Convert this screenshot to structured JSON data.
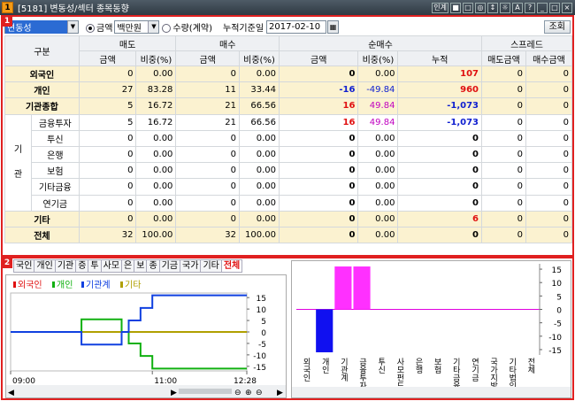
{
  "window": {
    "number": "1",
    "title": "[5181] 변동성/섹터 종목동향",
    "controls": [
      "인계",
      "■",
      "□",
      "◎",
      "↕",
      "☼",
      "A",
      "?",
      "_",
      "□",
      "×"
    ]
  },
  "toolbar": {
    "sector_value": "변동성",
    "radio_amount_label": "금액",
    "unit_value": "백만원",
    "radio_qty_label": "수량(계약)",
    "date_label": "누적기준일",
    "date_value": "2017-02-10",
    "query_button": "조회"
  },
  "table": {
    "group_headers": {
      "type": "구분",
      "sell": "매도",
      "buy": "매수",
      "net": "순매수",
      "spread": "스프레드"
    },
    "sub_headers": [
      "금액",
      "비중(%)",
      "금액",
      "비중(%)",
      "금액",
      "비중(%)",
      "누적",
      "매도금액",
      "매수금액"
    ],
    "institution_side_label": [
      "기",
      "관"
    ],
    "rows": [
      {
        "label": "외국인",
        "cells": [
          "0",
          "0.00",
          "0",
          "0.00",
          "0",
          "0.00",
          "107",
          "0",
          "0"
        ],
        "colors": [
          "",
          "",
          "",
          "",
          "",
          "",
          "red",
          "",
          ""
        ],
        "bold_label": true,
        "style": "y"
      },
      {
        "label": "개인",
        "cells": [
          "27",
          "83.28",
          "11",
          "33.44",
          "-16",
          "-49.84",
          "960",
          "0",
          "0"
        ],
        "colors": [
          "",
          "",
          "",
          "",
          "blue",
          "blue",
          "red",
          "",
          ""
        ],
        "bold_label": true,
        "style": "y"
      },
      {
        "label": "기관종합",
        "cells": [
          "5",
          "16.72",
          "21",
          "66.56",
          "16",
          "49.84",
          "-1,073",
          "0",
          "0"
        ],
        "colors": [
          "",
          "",
          "",
          "",
          "red",
          "mag",
          "blue",
          "",
          ""
        ],
        "bold_label": true,
        "style": "y"
      },
      {
        "label": "금융투자",
        "cells": [
          "5",
          "16.72",
          "21",
          "66.56",
          "16",
          "49.84",
          "-1,073",
          "0",
          "0"
        ],
        "colors": [
          "",
          "",
          "",
          "",
          "red",
          "mag",
          "blue",
          "",
          ""
        ],
        "bold_label": false,
        "style": ""
      },
      {
        "label": "투신",
        "cells": [
          "0",
          "0.00",
          "0",
          "0.00",
          "0",
          "0.00",
          "0",
          "0",
          "0"
        ],
        "colors": [
          "",
          "",
          "",
          "",
          "",
          "",
          "",
          "",
          ""
        ],
        "bold_label": false,
        "style": ""
      },
      {
        "label": "은행",
        "cells": [
          "0",
          "0.00",
          "0",
          "0.00",
          "0",
          "0.00",
          "0",
          "0",
          "0"
        ],
        "colors": [
          "",
          "",
          "",
          "",
          "",
          "",
          "",
          "",
          ""
        ],
        "bold_label": false,
        "style": ""
      },
      {
        "label": "보험",
        "cells": [
          "0",
          "0.00",
          "0",
          "0.00",
          "0",
          "0.00",
          "0",
          "0",
          "0"
        ],
        "colors": [
          "",
          "",
          "",
          "",
          "",
          "",
          "",
          "",
          ""
        ],
        "bold_label": false,
        "style": ""
      },
      {
        "label": "기타금융",
        "cells": [
          "0",
          "0.00",
          "0",
          "0.00",
          "0",
          "0.00",
          "0",
          "0",
          "0"
        ],
        "colors": [
          "",
          "",
          "",
          "",
          "",
          "",
          "",
          "",
          ""
        ],
        "bold_label": false,
        "style": ""
      },
      {
        "label": "연기금",
        "cells": [
          "0",
          "0.00",
          "0",
          "0.00",
          "0",
          "0.00",
          "0",
          "0",
          "0"
        ],
        "colors": [
          "",
          "",
          "",
          "",
          "",
          "",
          "",
          "",
          ""
        ],
        "bold_label": false,
        "style": ""
      },
      {
        "label": "기타",
        "cells": [
          "0",
          "0.00",
          "0",
          "0.00",
          "0",
          "0.00",
          "6",
          "0",
          "0"
        ],
        "colors": [
          "",
          "",
          "",
          "",
          "",
          "",
          "red",
          "",
          ""
        ],
        "bold_label": true,
        "style": "y"
      },
      {
        "label": "전체",
        "cells": [
          "32",
          "100.00",
          "32",
          "100.00",
          "0",
          "0.00",
          "0",
          "0",
          "0"
        ],
        "colors": [
          "",
          "",
          "",
          "",
          "",
          "",
          "",
          "",
          ""
        ],
        "bold_label": true,
        "style": "y"
      }
    ]
  },
  "pane2": {
    "number": "2",
    "tabs": [
      "국인",
      "개인",
      "기관",
      "증",
      "투",
      "사모",
      "은",
      "보",
      "종",
      "기금",
      "국가",
      "기타",
      "전체"
    ],
    "active_tab": "전체"
  },
  "chart_data": [
    {
      "type": "line",
      "legend": [
        "외국인",
        "개인",
        "기관계",
        "기타"
      ],
      "colors": [
        "#e01010",
        "#10b010",
        "#1040e0",
        "#b0a000"
      ],
      "x_ticks": [
        "09:00",
        "11:00",
        "12:28"
      ],
      "y_ticks": [
        15,
        10,
        5,
        0,
        -5,
        -10,
        -15
      ],
      "ylim": [
        -17,
        17
      ],
      "series": [
        {
          "name": "외국인",
          "color": "#e01010",
          "points": [
            [
              0,
              0
            ],
            [
              1,
              0
            ]
          ]
        },
        {
          "name": "기타",
          "color": "#b0a000",
          "points": [
            [
              0,
              0
            ],
            [
              1,
              0
            ]
          ]
        },
        {
          "name": "개인",
          "color": "#10b010",
          "points": [
            [
              0,
              0
            ],
            [
              0.3,
              0
            ],
            [
              0.3,
              5.5
            ],
            [
              0.47,
              5.5
            ],
            [
              0.47,
              0
            ],
            [
              0.5,
              0
            ],
            [
              0.5,
              -5
            ],
            [
              0.55,
              -5
            ],
            [
              0.55,
              -10.5
            ],
            [
              0.6,
              -10.5
            ],
            [
              0.6,
              -16
            ],
            [
              1,
              -16
            ]
          ]
        },
        {
          "name": "기관계",
          "color": "#1040e0",
          "points": [
            [
              0,
              0
            ],
            [
              0.3,
              0
            ],
            [
              0.3,
              -5.5
            ],
            [
              0.47,
              -5.5
            ],
            [
              0.47,
              0
            ],
            [
              0.5,
              0
            ],
            [
              0.5,
              5
            ],
            [
              0.55,
              5
            ],
            [
              0.55,
              10.5
            ],
            [
              0.6,
              10.5
            ],
            [
              0.6,
              16
            ],
            [
              1,
              16
            ]
          ]
        }
      ]
    },
    {
      "type": "bar",
      "categories": [
        "외국인",
        "개인",
        "기관계",
        "금융투자",
        "투신",
        "사모펀드",
        "은행",
        "보험",
        "기타금융",
        "연기금",
        "국가지방",
        "기타법인",
        "전체"
      ],
      "values": [
        0,
        -16,
        16,
        16,
        0,
        0,
        0,
        0,
        0,
        0,
        0,
        0,
        0
      ],
      "y_ticks": [
        15,
        10,
        5,
        0,
        -5,
        -10,
        -15
      ],
      "ylim": [
        -17,
        17
      ]
    }
  ]
}
